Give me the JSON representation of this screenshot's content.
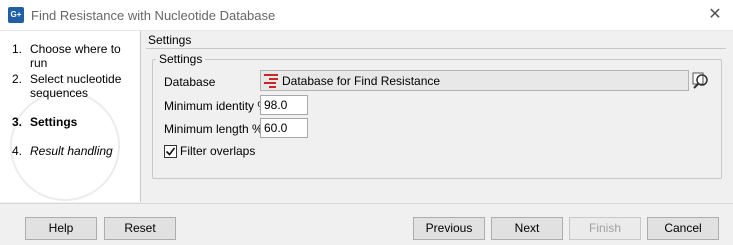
{
  "window": {
    "title": "Find Resistance with Nucleotide Database",
    "app_icon_text": "G+"
  },
  "steps": [
    {
      "num": "1.",
      "label": "Choose where to run"
    },
    {
      "num": "2.",
      "label": "Select nucleotide sequences"
    },
    {
      "num": "3.",
      "label": "Settings"
    },
    {
      "num": "4.",
      "label": "Result handling"
    }
  ],
  "main": {
    "header": "Settings",
    "group_title": "Settings",
    "database_label": "Database",
    "database_value": "Database for Find Resistance",
    "min_identity_label": "Minimum identity %",
    "min_identity_value": "98.0",
    "min_length_label": "Minimum length %",
    "min_length_value": "60.0",
    "filter_overlaps_label": "Filter overlaps",
    "filter_overlaps_checked": true
  },
  "footer": {
    "help": "Help",
    "reset": "Reset",
    "previous": "Previous",
    "next": "Next",
    "finish": "Finish",
    "cancel": "Cancel"
  },
  "icons": {
    "app": "genomics-app-icon",
    "close": "close-icon",
    "database": "database-list-icon",
    "browse": "browse-search-icon",
    "check": "checkmark-icon"
  },
  "colors": {
    "database_icon_red": "#c62828",
    "app_icon_blue": "#1f5fa8"
  }
}
